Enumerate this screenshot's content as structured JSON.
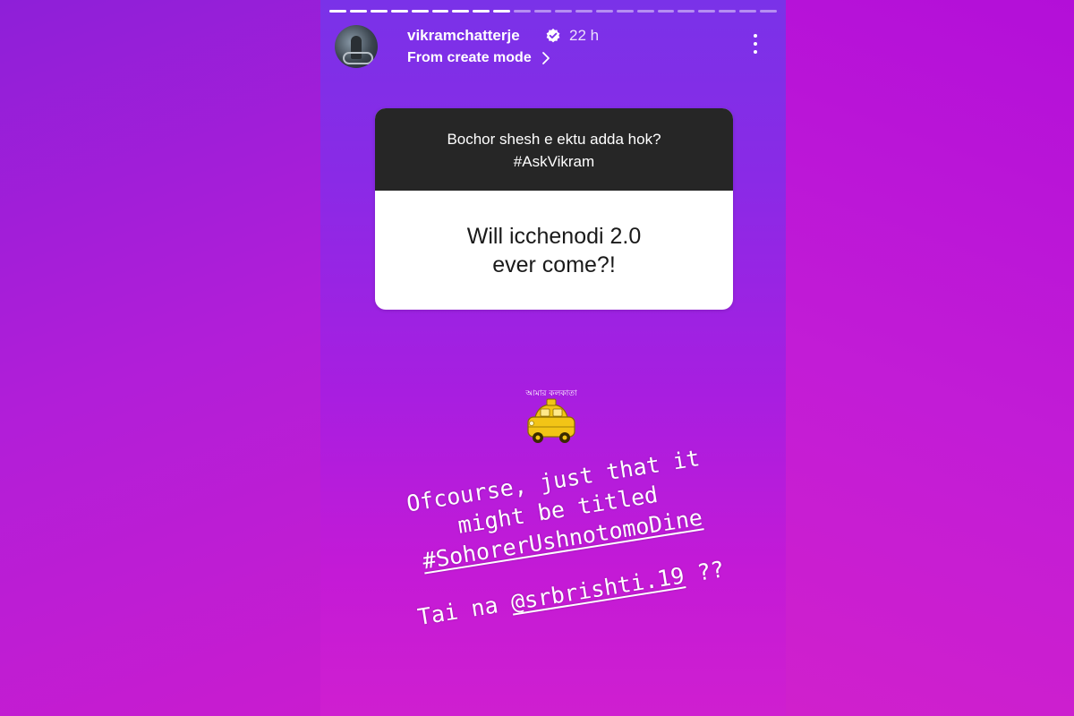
{
  "header": {
    "username": "vikramchatterje",
    "time": "22 h",
    "subline": "From create mode"
  },
  "progress": {
    "segments": 22,
    "completed": 9
  },
  "question_card": {
    "prompt_line1": "Bochor shesh e ektu adda hok?",
    "prompt_line2": "#AskVikram",
    "answer_line1": "Will icchenodi 2.0",
    "answer_line2": "ever come?!"
  },
  "sticker": {
    "text": "আমার কলকাতা"
  },
  "caption": {
    "line1": "Ofcourse, just that it",
    "line2": "might be titled",
    "hashtag": "#SohorerUshnotomoDine",
    "line4_prefix": "Tai na ",
    "mention": "@srbrishti.19",
    "line4_suffix": " ??"
  },
  "colors": {
    "story_top": "#7a32e8",
    "story_bottom": "#cf1fd0",
    "card_header": "#262626",
    "sticker_yellow": "#f2c416"
  },
  "icons": [
    "avatar",
    "verified-badge-icon",
    "chevron-right-icon",
    "more-vertical-icon",
    "taxi-sticker"
  ]
}
